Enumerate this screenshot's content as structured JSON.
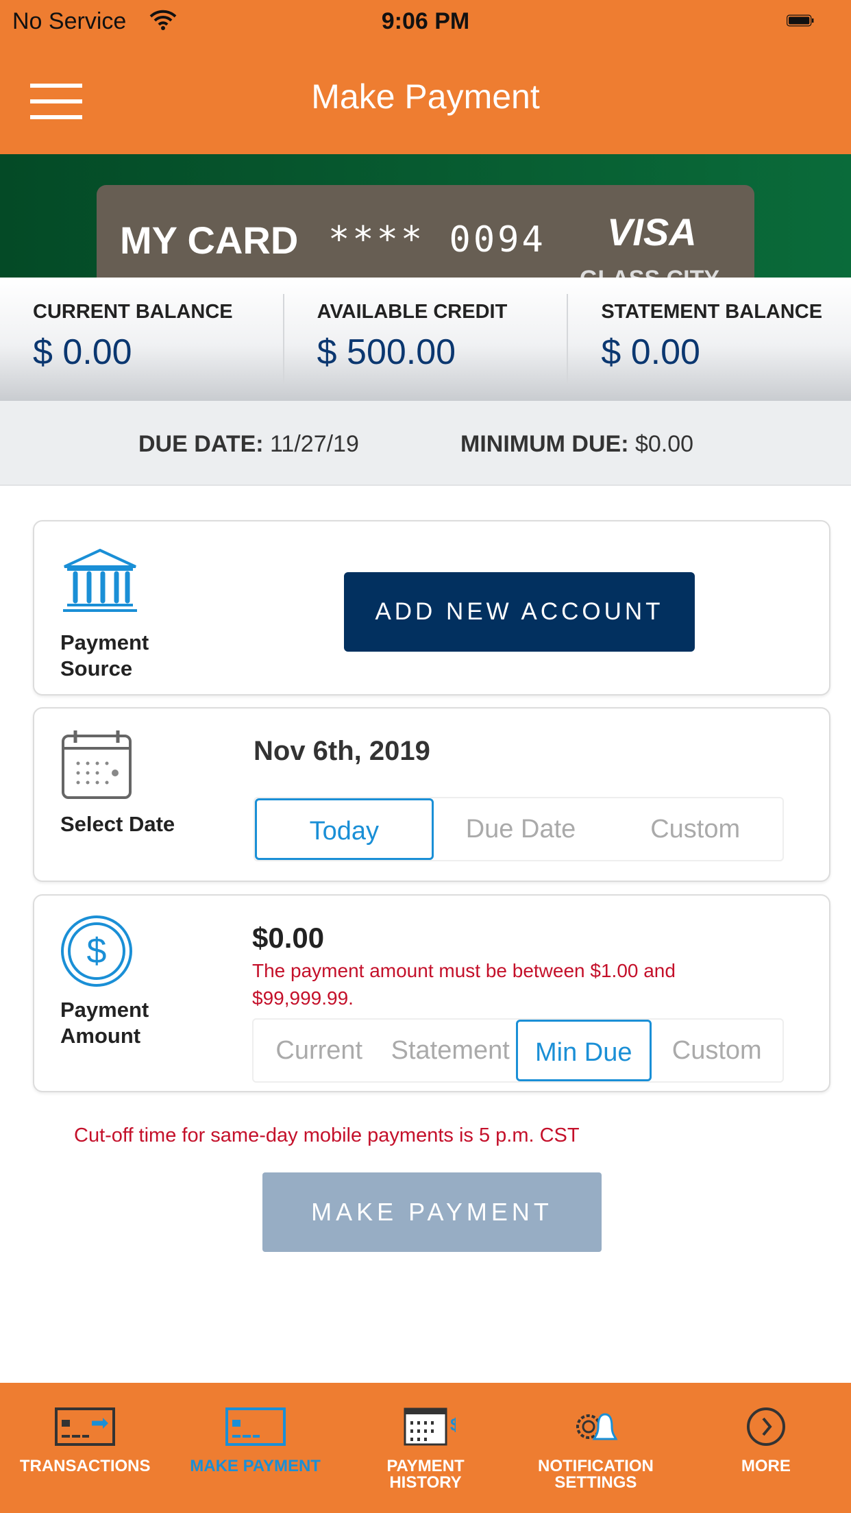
{
  "status_bar": {
    "carrier": "No Service",
    "time": "9:06 PM"
  },
  "header": {
    "title": "Make Payment"
  },
  "card": {
    "name": "MY CARD",
    "number": "**** 0094",
    "network": "VISA",
    "issuer": "GLASS CITY"
  },
  "balances": [
    {
      "label": "CURRENT BALANCE",
      "value": "$ 0.00"
    },
    {
      "label": "AVAILABLE CREDIT",
      "value": "$ 500.00"
    },
    {
      "label": "STATEMENT BALANCE",
      "value": "$ 0.00"
    }
  ],
  "due": {
    "due_label": "DUE DATE:",
    "due_value": "11/27/19",
    "min_label": "MINIMUM DUE:",
    "min_value": "$0.00"
  },
  "payment_source": {
    "label_line1": "Payment",
    "label_line2": "Source",
    "button": "ADD NEW ACCOUNT"
  },
  "select_date": {
    "label": "Select Date",
    "date": "Nov 6th, 2019",
    "options": [
      "Today",
      "Due Date",
      "Custom"
    ],
    "selected": "Today"
  },
  "payment_amount": {
    "label_line1": "Payment",
    "label_line2": "Amount",
    "amount": "$0.00",
    "error": "The payment amount must be between $1.00 and $99,999.99.",
    "options": [
      "Current",
      "Statement",
      "Min Due",
      "Custom"
    ],
    "selected": "Min Due"
  },
  "cutoff_note": "Cut-off time for same-day mobile payments is 5 p.m. CST",
  "make_payment_button": "MAKE PAYMENT",
  "tabs": [
    {
      "line1": "TRANSACTIONS",
      "line2": ""
    },
    {
      "line1": "MAKE PAYMENT",
      "line2": "",
      "active": true
    },
    {
      "line1": "PAYMENT",
      "line2": "HISTORY"
    },
    {
      "line1": "NOTIFICATION",
      "line2": "SETTINGS"
    },
    {
      "line1": "MORE",
      "line2": ""
    }
  ],
  "colors": {
    "brand_orange": "#ee7d31",
    "navy": "#02305f",
    "accent_blue": "#1a8fd6",
    "error_red": "#c4102a"
  }
}
